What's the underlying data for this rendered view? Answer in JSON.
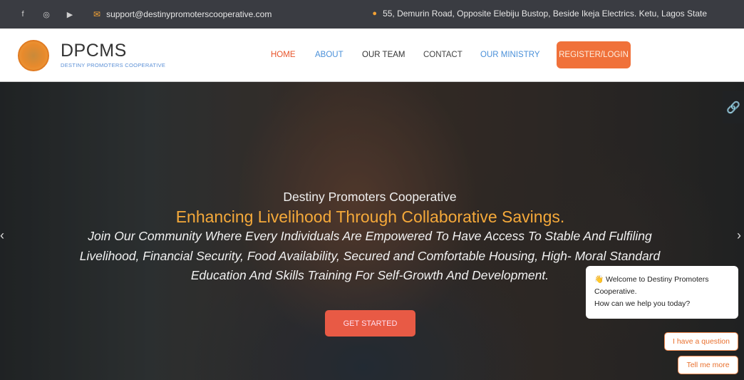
{
  "topbar": {
    "social": [
      {
        "icon": "facebook-icon",
        "glyph": "f"
      },
      {
        "icon": "instagram-icon",
        "glyph": "◎"
      },
      {
        "icon": "youtube-icon",
        "glyph": "▶"
      }
    ],
    "email": "support@destinypromoterscooperative.com",
    "address": "55, Demurin Road, Opposite Elebiju Bustop, Beside Ikeja Electrics. Ketu, Lagos State"
  },
  "header": {
    "brand": "DPCMS",
    "tagline": "DESTINY PROMOTERS COOPERATIVE",
    "nav": [
      {
        "label": "HOME",
        "color": "#e8542a"
      },
      {
        "label": "ABOUT",
        "color": "#4a90d9"
      },
      {
        "label": "OUR TEAM",
        "color": "#333333"
      },
      {
        "label": "CONTACT",
        "color": "#444444"
      },
      {
        "label": "OUR MINISTRY",
        "color": "#4a90d9"
      }
    ],
    "register": "REGISTER/LOGIN"
  },
  "hero": {
    "kicker": "Destiny Promoters Cooperative",
    "headline": "Enhancing Livelihood Through Collaborative Savings.",
    "body": "Join Our Community Where Every Individuals Are Empowered To Have Access To Stable And Fulfiling Livelihood, Financial Security, Food Availability, Secured and Comfortable Housing, High- Moral Standard Education And Skills Training For Self-Growth And Development.",
    "cta": "GET STARTED"
  },
  "chat": {
    "wave": "👋",
    "line1": "Welcome to Destiny Promoters Cooperative.",
    "line2": "How can we help you today?",
    "reply1": "I have a question",
    "reply2": "Tell me more"
  }
}
